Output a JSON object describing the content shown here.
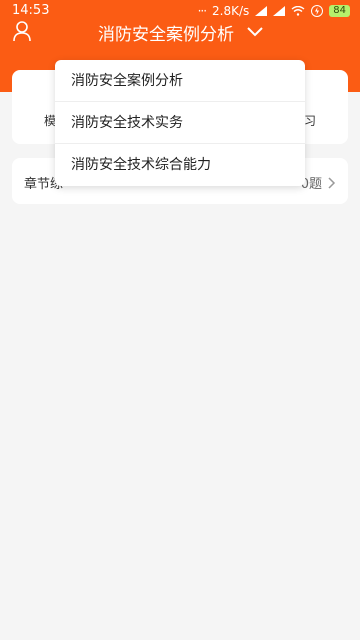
{
  "statusbar": {
    "time": "14:53",
    "speed": "2.8K/s",
    "battery": "84"
  },
  "header": {
    "title": "消防安全案例分析"
  },
  "card": {
    "left_label": "模",
    "right_label": "习"
  },
  "chapter_row": {
    "label": "章节练",
    "count": "0题"
  },
  "dropdown": {
    "items": [
      {
        "label": "消防安全案例分析"
      },
      {
        "label": "消防安全技术实务"
      },
      {
        "label": "消防安全技术综合能力"
      }
    ]
  }
}
